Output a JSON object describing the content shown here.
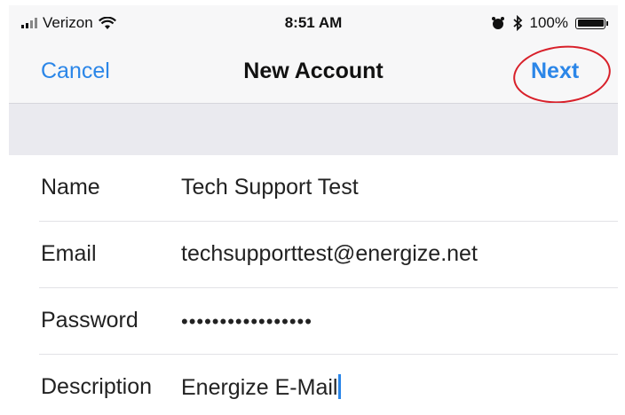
{
  "status_bar": {
    "carrier": "Verizon",
    "time": "8:51 AM",
    "battery": "100%",
    "icons": [
      "signal-bars-icon",
      "wifi-icon",
      "alarm-icon",
      "bluetooth-icon",
      "battery-icon"
    ]
  },
  "nav": {
    "cancel_label": "Cancel",
    "title": "New Account",
    "next_label": "Next"
  },
  "form": {
    "fields": [
      {
        "label": "Name",
        "value": "Tech Support Test"
      },
      {
        "label": "Email",
        "value": "techsupporttest@energize.net"
      },
      {
        "label": "Password",
        "value": "•••••••••••••••••"
      },
      {
        "label": "Description",
        "value": "Energize E-Mail"
      }
    ]
  },
  "colors": {
    "accent": "#2b86e8",
    "annotation": "#d8202a"
  }
}
